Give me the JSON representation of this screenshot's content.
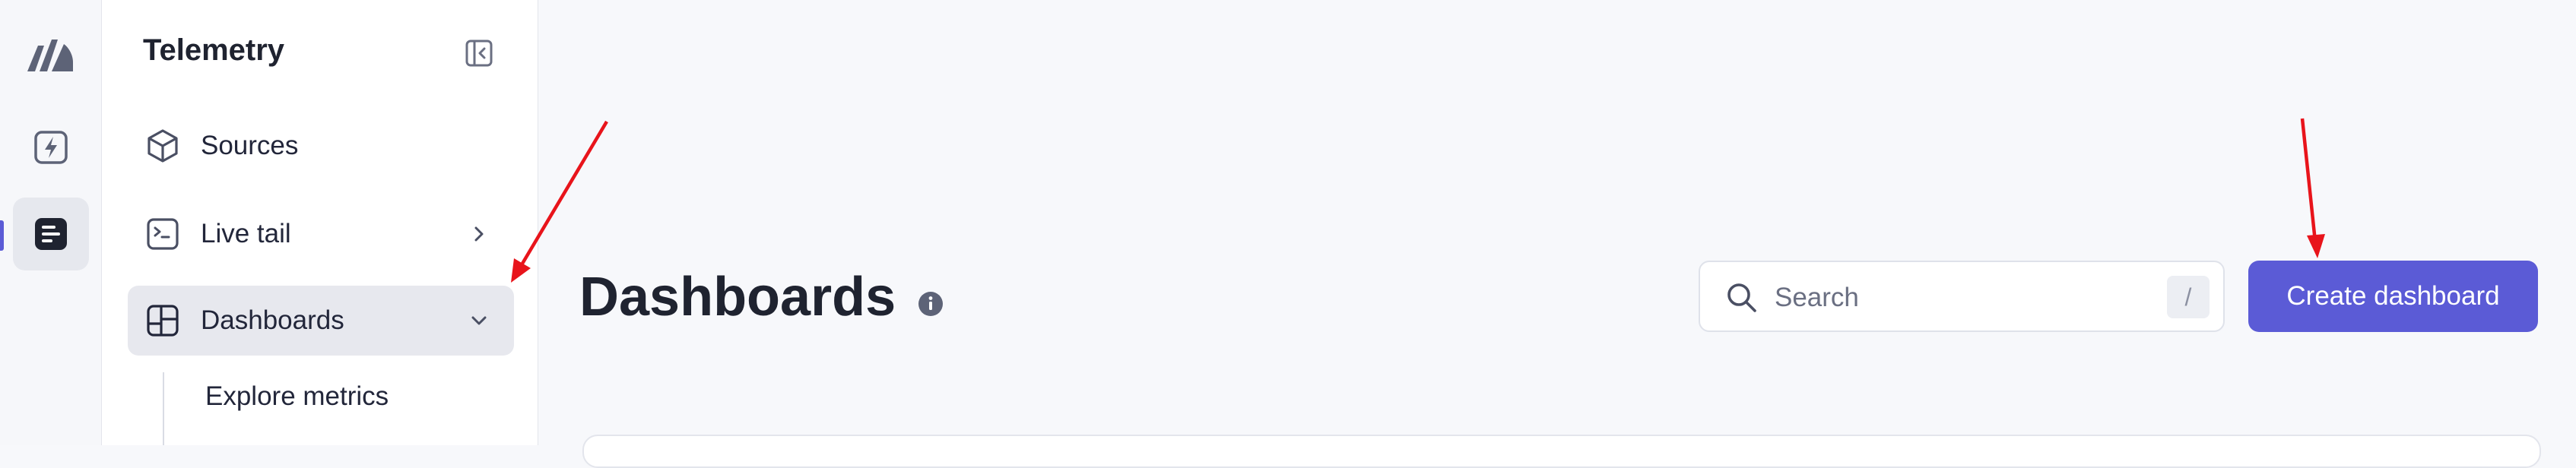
{
  "app": {
    "section_title": "Telemetry"
  },
  "sidebar": {
    "items": [
      {
        "label": "Sources",
        "icon": "cube-icon"
      },
      {
        "label": "Live tail",
        "icon": "terminal-icon"
      },
      {
        "label": "Dashboards",
        "icon": "dashboard-icon"
      }
    ],
    "sub_items": [
      {
        "label": "Explore metrics"
      }
    ]
  },
  "rail": {
    "items": [
      {
        "icon": "bolt-icon"
      },
      {
        "icon": "telemetry-icon",
        "active": true
      }
    ]
  },
  "main": {
    "title": "Dashboards",
    "search": {
      "placeholder": "Search",
      "shortcut": "/"
    },
    "create_button": "Create dashboard"
  },
  "colors": {
    "accent": "#5b5bd6",
    "annotation_arrow": "#e8141b"
  }
}
